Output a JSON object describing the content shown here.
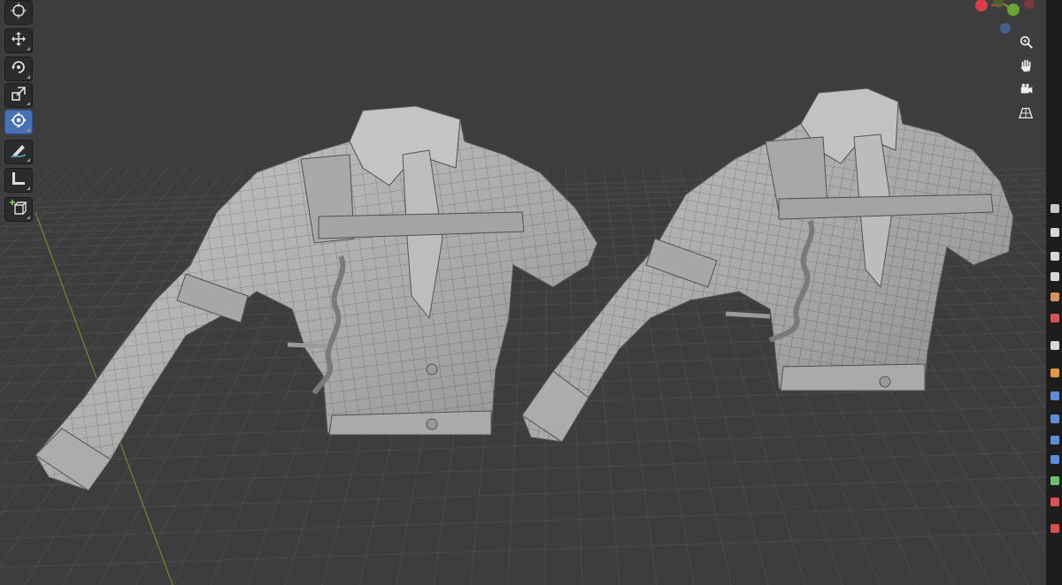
{
  "viewport": {
    "background": "#3d3d3d",
    "grid_line": "#4a4a4a",
    "y_axis_color": "#6e8b2e",
    "mesh_fill": "#b9b9b9",
    "wire_color": "#6b6b6b"
  },
  "toolbar": {
    "tools": [
      {
        "icon": "cursor-icon",
        "active": false
      },
      {
        "icon": "move-icon",
        "active": false
      },
      {
        "icon": "rotate-icon",
        "active": false
      },
      {
        "icon": "scale-icon",
        "active": false
      },
      {
        "icon": "transform-icon",
        "active": true
      },
      {
        "icon": "annotate-icon",
        "active": false
      },
      {
        "icon": "measure-icon",
        "active": false
      },
      {
        "icon": "add-cube-icon",
        "active": false
      }
    ],
    "active_color": "#4772b3"
  },
  "navigation": {
    "gizmo_colors": {
      "x": "#d63c4b",
      "y": "#6aa533",
      "z": "#4a7fd1"
    },
    "buttons": [
      "zoom-icon",
      "pan-hand-icon",
      "camera-icon",
      "perspective-grid-icon"
    ]
  },
  "properties_tabs": [
    "tool-icon",
    "render-icon",
    "output-icon",
    "view-layer-icon",
    "scene-icon",
    "world-icon",
    "collection-icon",
    "object-icon",
    "modifier-icon",
    "particles-icon",
    "physics-icon",
    "constraints-icon",
    "data-icon",
    "material-icon",
    "texture-icon"
  ],
  "properties_tab_colors": [
    "#c8c8c8",
    "#d7d7d7",
    "#d7d7d7",
    "#d7d7d7",
    "#d9935a",
    "#d85050",
    "#d7d7d7",
    "#e29a46",
    "#5c8dd8",
    "#5c8dd8",
    "#5c8dd8",
    "#5c8dd8",
    "#6bc06b",
    "#d85050",
    "#d85050"
  ]
}
